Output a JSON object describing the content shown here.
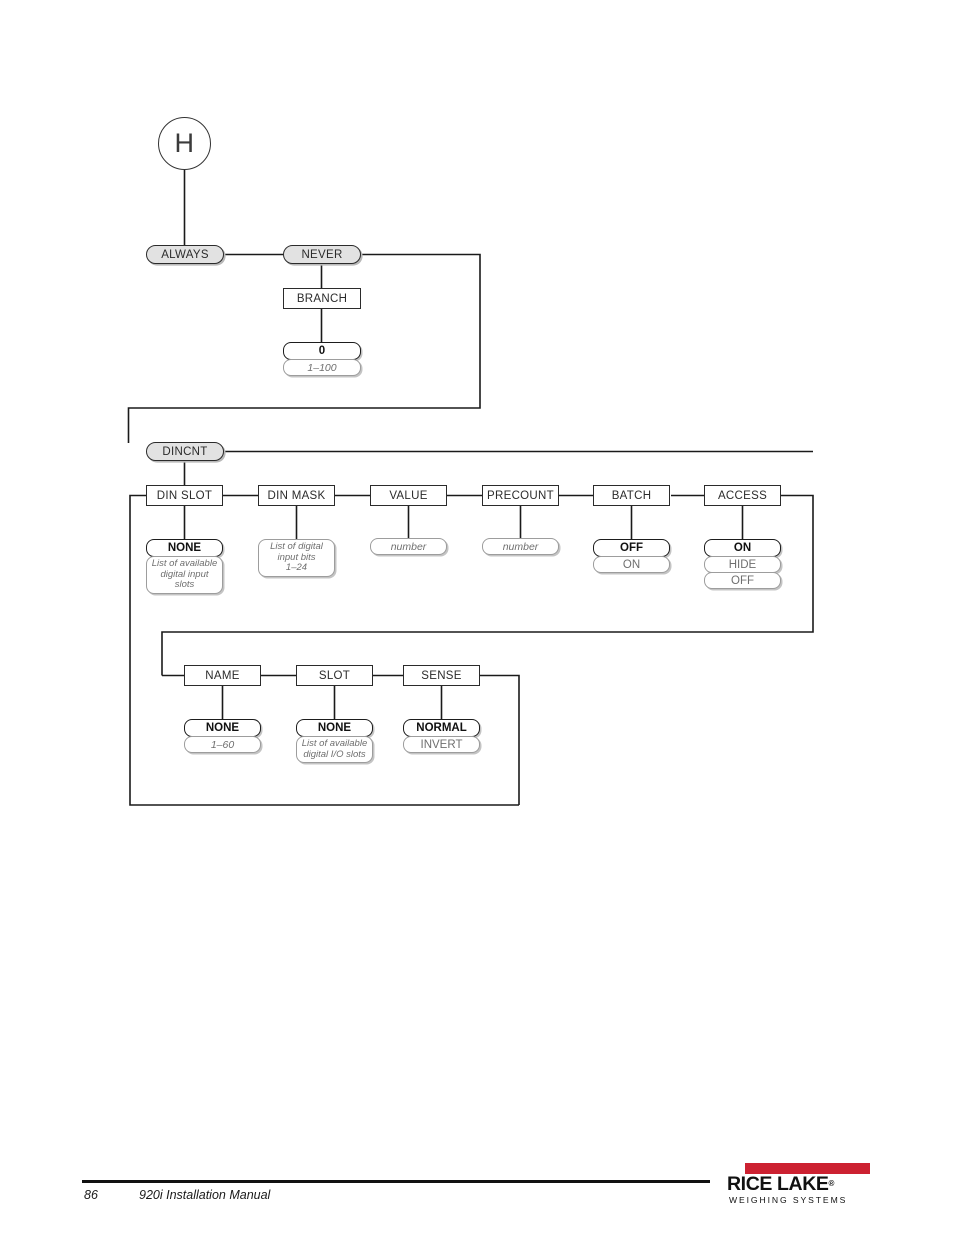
{
  "document": {
    "footer": {
      "page_number": "86",
      "title": "920i Installation Manual",
      "logo_name": "RICE LAKE",
      "logo_registered": "®",
      "logo_tagline": "WEIGHING SYSTEMS",
      "logo_bar_color": "#cc2131"
    }
  },
  "diagram": {
    "entry": {
      "label": "H"
    },
    "menus": {
      "always": "ALWAYS",
      "never": "NEVER",
      "dincnt": "DINCNT"
    },
    "branch": {
      "label": "BRANCH",
      "default": "0",
      "range": "1–100"
    },
    "dincnt_params": [
      {
        "label": "DIN SLOT",
        "values": [
          {
            "text": "NONE",
            "style": "first"
          },
          {
            "text": "List of available\ndigital input\nslots",
            "style": "note"
          }
        ]
      },
      {
        "label": "DIN MASK",
        "values": [
          {
            "text": "List of digital\ninput bits\n1–24",
            "style": "note-solo"
          }
        ]
      },
      {
        "label": "VALUE",
        "values": [
          {
            "text": "number",
            "style": "ital"
          }
        ]
      },
      {
        "label": "PRECOUNT",
        "values": [
          {
            "text": "number",
            "style": "ital"
          }
        ]
      },
      {
        "label": "BATCH",
        "values": [
          {
            "text": "OFF",
            "style": "first"
          },
          {
            "text": "ON",
            "style": "alt"
          }
        ]
      },
      {
        "label": "ACCESS",
        "values": [
          {
            "text": "ON",
            "style": "first"
          },
          {
            "text": "HIDE",
            "style": "alt"
          },
          {
            "text": "OFF",
            "style": "alt"
          }
        ]
      }
    ],
    "dincnt_params_row2": [
      {
        "label": "NAME",
        "values": [
          {
            "text": "NONE",
            "style": "first"
          },
          {
            "text": "1–60",
            "style": "ital"
          }
        ]
      },
      {
        "label": "SLOT",
        "values": [
          {
            "text": "NONE",
            "style": "first"
          },
          {
            "text": "List of available\ndigital I/O slots",
            "style": "note"
          }
        ]
      },
      {
        "label": "SENSE",
        "values": [
          {
            "text": "NORMAL",
            "style": "first"
          },
          {
            "text": "INVERT",
            "style": "alt"
          }
        ]
      }
    ]
  }
}
